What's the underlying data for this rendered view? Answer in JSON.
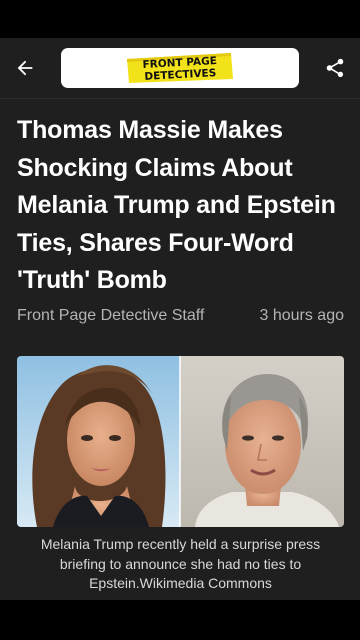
{
  "toolbar": {
    "back_icon": "arrow-left-icon",
    "share_icon": "share-icon",
    "logo_line1": "FRONT PAGE",
    "logo_line2": "DETECTIVES"
  },
  "article": {
    "headline": "Thomas Massie Makes Shocking Claims About Melania Trump and Epstein Ties, Shares Four-Word 'Truth' Bomb",
    "author": "Front Page Detective Staff",
    "time": "3 hours ago",
    "caption": "Melania Trump recently held a surprise press briefing to announce she had no ties to Epstein.Wikimedia Commons"
  },
  "colors": {
    "background": "#1f1f1f",
    "logo_yellow": "#f2e21a",
    "headline": "#ffffff",
    "byline": "#b4b4b4"
  }
}
